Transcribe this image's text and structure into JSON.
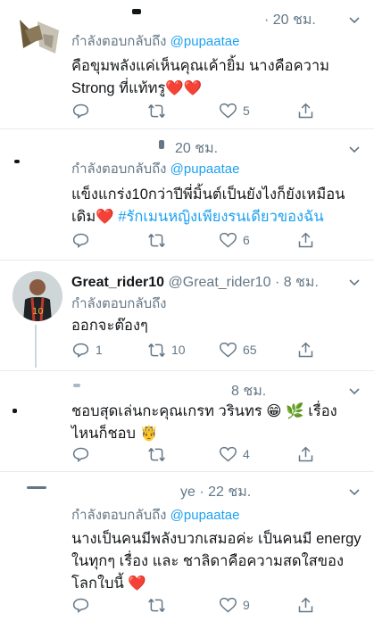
{
  "tweets": [
    {
      "time": "· 20 ชม.",
      "replying_prefix": "กำลังตอบกลับถึง",
      "replying_to": "@pupaatae",
      "text": "คือขุมพลังแค่เห็นคุณเค้ายิ้ม นางคือความ Strong ที่แท้ทรู❤️❤️",
      "likes": "5"
    },
    {
      "time": "20 ชม.",
      "replying_prefix": "กำลังตอบกลับถึง",
      "replying_to": "@pupaatae",
      "text": "แข็งแกร่ง10กว่าปีพี่มิ้นต์เป็นยังไงก็ยังเหมือนเดิม❤️",
      "hashtag": "#รักเมนหญิงเพียงรนเดียวของฉัน",
      "likes": "6"
    },
    {
      "name": "Great_rider10",
      "handle": "@Great_rider10",
      "time": "· 8 ชม.",
      "replying_prefix": "กำลังตอบกลับถึง",
      "text": "ออกจะต๊องๆ",
      "replies": "1",
      "retweets": "10",
      "likes": "65"
    },
    {
      "time": "8 ชม.",
      "text": "ชอบสุดเล่นกะคุณเกรท วรินทร 😁 🌿 เรื่องไหนก็ชอบ 🤴",
      "likes": "4"
    },
    {
      "time": "ye · 22 ชม.",
      "replying_prefix": "กำลังตอบกลับถึง",
      "replying_to": "@pupaatae",
      "text": "นางเป็นคนมีพลังบวกเสมอค่ะ เป็นคนมี energy ในทุกๆ เรื่อง และ ชาลิดาคือความสดใสของโลกใบนี้ ❤️",
      "likes": "9"
    }
  ]
}
